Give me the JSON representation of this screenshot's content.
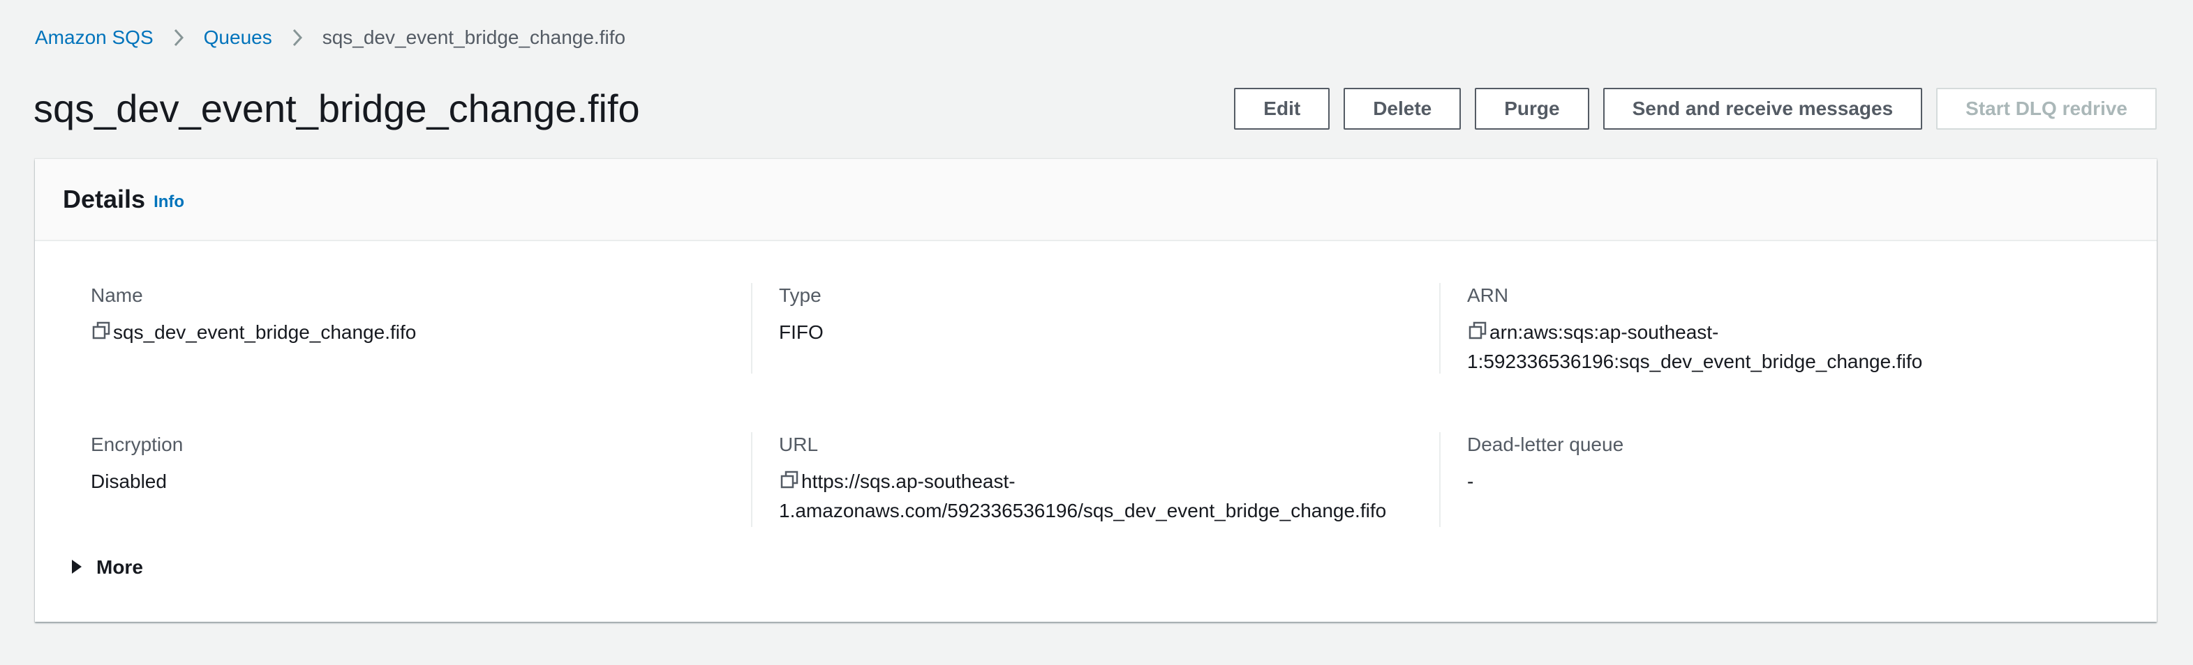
{
  "breadcrumb": {
    "items": [
      "Amazon SQS",
      "Queues"
    ],
    "current": "sqs_dev_event_bridge_change.fifo"
  },
  "page": {
    "title": "sqs_dev_event_bridge_change.fifo"
  },
  "actions": {
    "edit": "Edit",
    "delete": "Delete",
    "purge": "Purge",
    "send_receive": "Send and receive messages",
    "start_dlq": "Start DLQ redrive"
  },
  "details": {
    "title": "Details",
    "info": "Info",
    "fields": {
      "name": {
        "label": "Name",
        "value": "sqs_dev_event_bridge_change.fifo"
      },
      "type": {
        "label": "Type",
        "value": "FIFO"
      },
      "arn": {
        "label": "ARN",
        "value_line1": "arn:aws:sqs:ap-southeast-",
        "value_line2": "1:592336536196:sqs_dev_event_bridge_change.fifo"
      },
      "encryption": {
        "label": "Encryption",
        "value": "Disabled"
      },
      "url": {
        "label": "URL",
        "value_line1": "https://sqs.ap-southeast-",
        "value_line2": "1.amazonaws.com/592336536196/sqs_dev_event_bridge_change.fifo"
      },
      "dlq": {
        "label": "Dead-letter queue",
        "value": "-"
      }
    },
    "more": "More"
  },
  "icons": [
    "chevron-right-icon",
    "copy-icon",
    "caret-right-icon"
  ],
  "colors": {
    "link": "#0073bb",
    "text": "#16191f",
    "muted": "#545b64",
    "background": "#f2f3f3"
  }
}
